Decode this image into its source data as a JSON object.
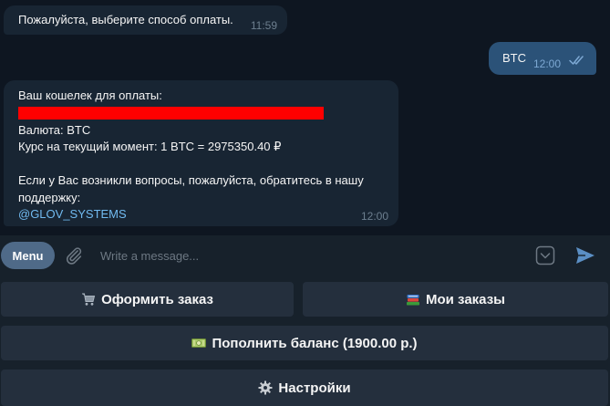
{
  "messages": [
    {
      "text": "Пожалуйста, выберите способ оплаты.",
      "time": "11:59"
    },
    {
      "text": "BTC",
      "time": "12:00",
      "status": "read"
    },
    {
      "line1": "Ваш кошелек для оплаты:",
      "line2": "Валюта: BTC",
      "line3": "Курс на текущий момент: 1 BTC = 2975350.40 ₽",
      "line4": "Если у Вас возникли вопросы, пожалуйста, обратитесь в нашу",
      "line5": "поддержку:",
      "link": "@GLOV_SYSTEMS",
      "time": "12:00"
    }
  ],
  "composer": {
    "menu_label": "Menu",
    "placeholder": "Write a message..."
  },
  "keyboard": {
    "order": "Оформить заказ",
    "my_orders": "Мои заказы",
    "topup": "Пополнить баланс (1900.00 р.)",
    "settings": "Настройки"
  },
  "icons": {
    "order": "shopping-cart-icon",
    "my_orders": "books-icon",
    "topup": "dollar-banknote-icon",
    "settings": "gear-icon"
  },
  "colors": {
    "chat_bg": "#0e1621",
    "bubble_in": "#182533",
    "bubble_out": "#2b5278",
    "link": "#71baf0",
    "redaction": "#fe0000",
    "keyboard_button": "#242f3d",
    "menu_button": "#4f6a88"
  }
}
